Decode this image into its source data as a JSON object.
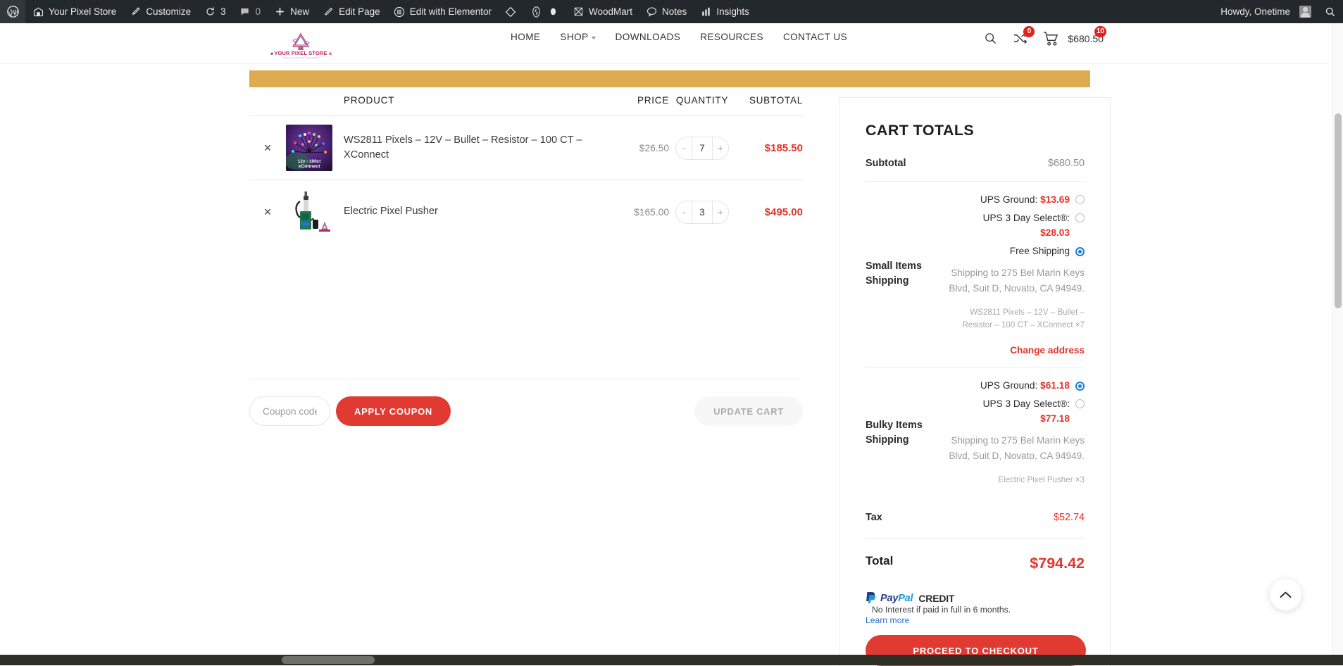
{
  "admin_bar": {
    "items": [
      {
        "icon": "wordpress-logo-icon",
        "label": ""
      },
      {
        "icon": "site-icon",
        "label": "Your Pixel Store"
      },
      {
        "icon": "brush-icon",
        "label": "Customize"
      },
      {
        "icon": "updates-icon",
        "label": "3"
      },
      {
        "icon": "comments-icon",
        "label": "0"
      },
      {
        "icon": "plus-icon",
        "label": "New"
      },
      {
        "icon": "pencil-icon",
        "label": "Edit Page"
      },
      {
        "icon": "elementor-icon",
        "label": "Edit with Elementor"
      },
      {
        "icon": "diamond-icon",
        "label": ""
      },
      {
        "icon": "jetpack-icon",
        "label": ""
      },
      {
        "icon": "dot-icon",
        "label": ""
      },
      {
        "icon": "woodmart-icon",
        "label": "WoodMart"
      },
      {
        "icon": "notes-icon",
        "label": "Notes"
      },
      {
        "icon": "insights-icon",
        "label": "Insights"
      }
    ],
    "howdy": "Howdy, Onetime",
    "search_icon": "search-icon"
  },
  "header": {
    "logo_alt": "Your Pixel Store",
    "logo_text": "YOUR PIXEL STORE",
    "nav": [
      {
        "label": "HOME",
        "has_caret": false
      },
      {
        "label": "SHOP",
        "has_caret": true
      },
      {
        "label": "DOWNLOADS",
        "has_caret": false
      },
      {
        "label": "RESOURCES",
        "has_caret": false
      },
      {
        "label": "CONTACT US",
        "has_caret": false
      }
    ],
    "search_icon": "search-icon",
    "compare_icon": "compare-icon",
    "compare_count": "0",
    "cart_icon": "cart-icon",
    "cart_count": "10",
    "cart_amount": "$680.50"
  },
  "cart_table": {
    "columns": {
      "product": "PRODUCT",
      "price": "PRICE",
      "quantity": "QUANTITY",
      "subtotal": "SUBTOTAL"
    },
    "rows": [
      {
        "remove": "×",
        "name": "WS2811 Pixels – 12V – Bullet – Resistor – 100 CT – XConnect",
        "price": "$26.50",
        "qty": "7",
        "minus": "-",
        "plus": "+",
        "subtotal": "$185.50",
        "thumb": "ws2811-pixels-thumbnail",
        "thumb_caption_1": "12v - 100ct",
        "thumb_caption_2": "xConnect"
      },
      {
        "remove": "×",
        "name": "Electric Pixel Pusher",
        "price": "$165.00",
        "qty": "3",
        "minus": "-",
        "plus": "+",
        "subtotal": "$495.00",
        "thumb": "electric-pixel-pusher-thumbnail",
        "thumb_caption_1": "",
        "thumb_caption_2": ""
      }
    ],
    "coupon_placeholder": "Coupon code",
    "coupon_value": "",
    "apply_coupon": "APPLY COUPON",
    "update_cart": "UPDATE CART"
  },
  "cart_totals": {
    "title": "CART TOTALS",
    "subtotal_label": "Subtotal",
    "subtotal_value": "$680.50",
    "shipping_groups": [
      {
        "label": "Small Items Shipping",
        "options": [
          {
            "name": "UPS Ground:",
            "amount": "$13.69",
            "selected": false
          },
          {
            "name": "UPS 3 Day Select®:",
            "amount": "$28.03",
            "selected": false
          },
          {
            "name": "Free Shipping",
            "amount": "",
            "selected": true
          }
        ],
        "destination": "Shipping to 275 Bel Marin Keys Blvd, Suit D, Novato, CA 94949.",
        "items": "WS2811 Pixels – 12V – Bullet – Resistor – 100 CT – XConnect ×7",
        "change_address": "Change address"
      },
      {
        "label": "Bulky Items Shipping",
        "options": [
          {
            "name": "UPS Ground:",
            "amount": "$61.18",
            "selected": true
          },
          {
            "name": "UPS 3 Day Select®:",
            "amount": "$77.18",
            "selected": false
          }
        ],
        "destination": "Shipping to 275 Bel Marin Keys Blvd, Suit D, Novato, CA 94949.",
        "items": "Electric Pixel Pusher ×3",
        "change_address": ""
      }
    ],
    "tax_label": "Tax",
    "tax_value": "$52.74",
    "total_label": "Total",
    "total_value": "$794.42",
    "paypal": {
      "pay": "Pay",
      "pal": "Pal",
      "credit": "CREDIT",
      "text": "No Interest if paid in full in 6 months.",
      "learn_more": "Learn more"
    },
    "checkout_label": "PROCEED TO CHECKOUT"
  },
  "chrome": {
    "scroll_top_icon": "chevron-up-icon"
  },
  "colors": {
    "accent_red": "#e4342b",
    "notice_gold": "#dfab51",
    "radio_blue": "#1a7fd4",
    "admin_bar": "#23282d"
  }
}
